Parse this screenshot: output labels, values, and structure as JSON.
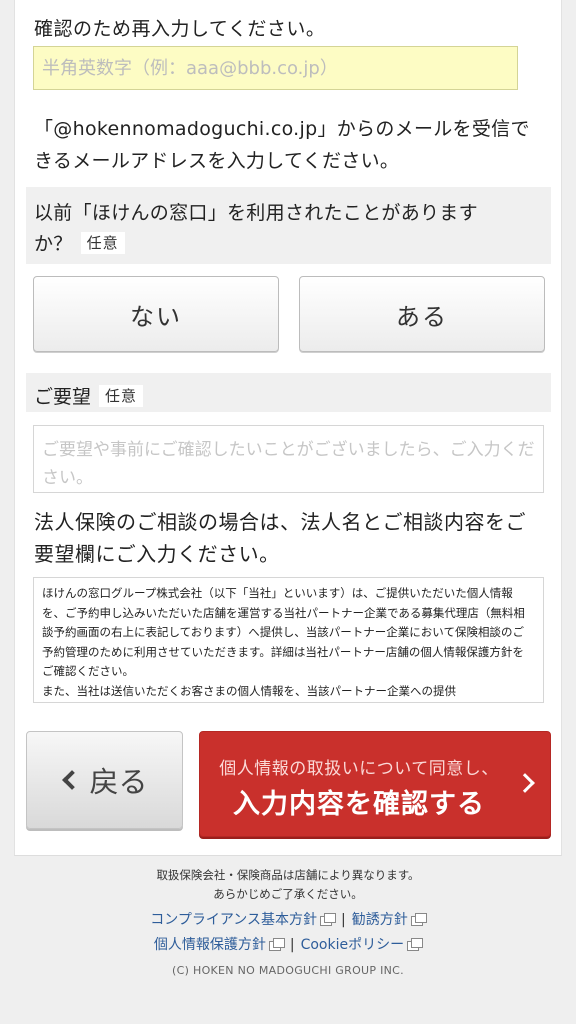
{
  "form": {
    "email_confirm_label": "確認のため再入力してください。",
    "email_confirm_placeholder": "半角英数字（例：aaa@bbb.co.jp）",
    "email_note": "「@hokennomadoguchi.co.jp」からのメールを受信できるメールアドレスを入力してください。",
    "previous_use_question": "以前「ほけんの窓口」を利用されたことがありますか？",
    "optional_badge": "任意",
    "previous_use_options": [
      "ない",
      "ある"
    ],
    "request_label": "ご要望",
    "request_placeholder": "ご要望や事前にご確認したいことがございましたら、ご入力ください。",
    "corporate_note": "法人保険のご相談の場合は、法人名とご相談内容をご要望欄にご入力ください。",
    "privacy_text": "ほけんの窓口グループ株式会社（以下「当社」といいます）は、ご提供いただいた個人情報を、ご予約申し込みいただいた店舗を運営する当社パートナー企業である募集代理店（無料相談予約画面の右上に表記しております）へ提供し、当該パートナー企業において保険相談のご予約管理のために利用させていただきます。詳細は当社パートナー店舗の個人情報保護方針をご確認ください。\nまた、当社は送信いただくお客さまの個人情報を、当該パートナー企業への提供"
  },
  "actions": {
    "back_label": "戻る",
    "confirm_sub_label": "個人情報の取扱いについて同意し、",
    "confirm_main_label": "入力内容を確認する"
  },
  "footer": {
    "note_line1": "取扱保険会社・保険商品は店舗により異なります。",
    "note_line2": "あらかじめご了承ください。",
    "links": {
      "compliance": "コンプライアンス基本方針",
      "solicitation": "勧誘方針",
      "privacy_policy": "個人情報保護方針",
      "cookie_policy": "Cookieポリシー"
    },
    "copyright": "(C) HOKEN NO MADOGUCHI GROUP INC."
  },
  "colors": {
    "accent_red": "#c9302c",
    "input_highlight": "#fdfcc4",
    "link_blue": "#2e5d9a"
  }
}
